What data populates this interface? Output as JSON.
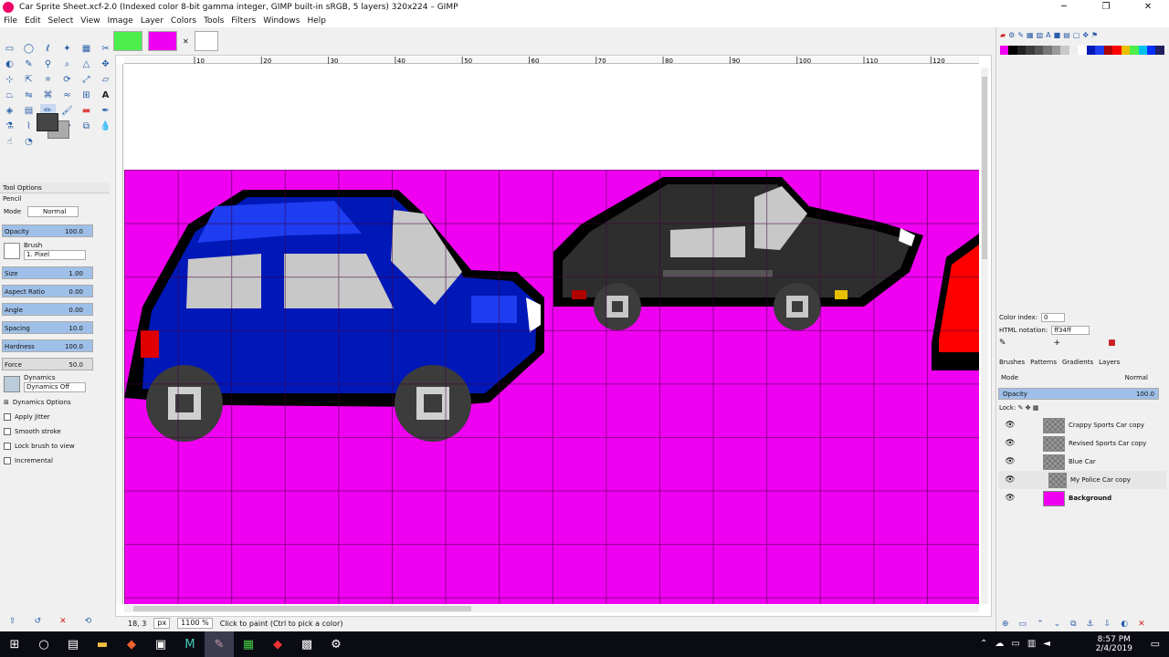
{
  "window": {
    "title": "Car Sprite Sheet.xcf-2.0 (Indexed color 8-bit gamma integer, GIMP built-in sRGB, 5 layers) 320x224 – GIMP",
    "minimize": "─",
    "maximize": "❐",
    "close": "✕"
  },
  "menu": [
    "File",
    "Edit",
    "Select",
    "View",
    "Image",
    "Layer",
    "Colors",
    "Tools",
    "Filters",
    "Windows",
    "Help"
  ],
  "tool_options": {
    "header": "Tool Options",
    "tool_name": "Pencil",
    "mode_label": "Mode",
    "mode_value": "Normal",
    "opacity_label": "Opacity",
    "opacity_value": "100.0",
    "brush_label": "Brush",
    "brush_value": "1. Pixel",
    "size_label": "Size",
    "size_value": "1.00",
    "aspect_label": "Aspect Ratio",
    "aspect_value": "0.00",
    "angle_label": "Angle",
    "angle_value": "0.00",
    "spacing_label": "Spacing",
    "spacing_value": "10.0",
    "hardness_label": "Hardness",
    "hardness_value": "100.0",
    "force_label": "Force",
    "force_value": "50.0",
    "dynamics_label": "Dynamics",
    "dynamics_value": "Dynamics Off",
    "dynamics_options": "Dynamics Options",
    "apply_jitter": "Apply Jitter",
    "smooth_stroke": "Smooth stroke",
    "lock_brush": "Lock brush to view",
    "incremental": "Incremental"
  },
  "ruler_labels": [
    "10",
    "20",
    "30",
    "40",
    "50",
    "60",
    "70",
    "80",
    "90",
    "100",
    "110",
    "120"
  ],
  "status": {
    "coords": "18, 3",
    "unit": "px",
    "zoom": "1100 %",
    "message": "Click to paint (Ctrl to pick a color)"
  },
  "colormap": {
    "color_index_label": "Color index:",
    "color_index_value": "0",
    "html_label": "HTML notation:",
    "html_value": "ff34ff"
  },
  "docker_tabs": [
    "Brushes",
    "Patterns",
    "Gradients",
    "Layers"
  ],
  "layers_panel": {
    "mode_label": "Mode",
    "mode_value": "Normal",
    "opacity_label": "Opacity",
    "opacity_value": "100.0",
    "lock_label": "Lock:",
    "layers": [
      "Crappy Sports Car copy",
      "Revised Sports Car copy",
      "Blue Car",
      "My Police Car copy",
      "Background"
    ]
  },
  "clock": {
    "time": "8:57 PM",
    "date": "2/4/2019"
  },
  "colors": {
    "canvas": "#f000f0",
    "fg": "#444444",
    "bg": "#aaaaaa"
  }
}
